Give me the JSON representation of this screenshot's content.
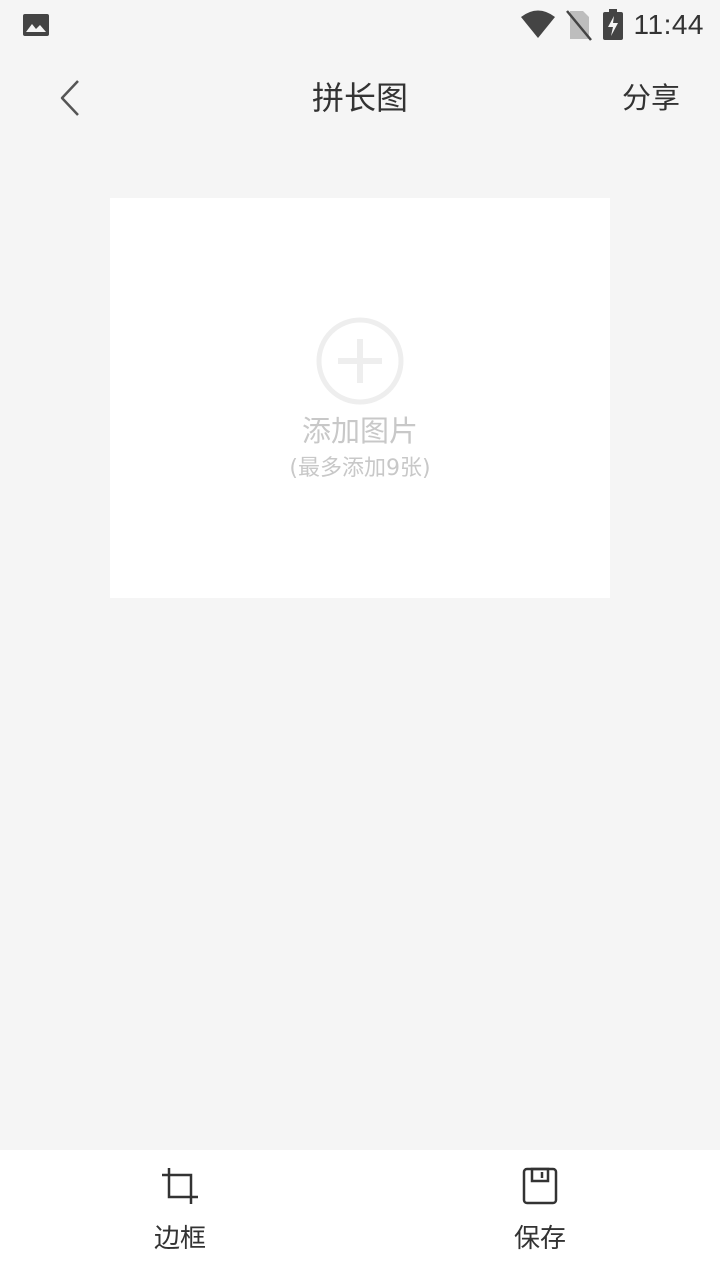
{
  "status_bar": {
    "left_icon": "image-icon",
    "icons": [
      "wifi-icon",
      "no-sim-icon",
      "battery-charging-icon"
    ],
    "time": "11:44"
  },
  "header": {
    "back_icon": "chevron-left-icon",
    "title": "拼长图",
    "share_label": "分享"
  },
  "canvas": {
    "add_icon": "plus-circle-icon",
    "add_title": "添加图片",
    "add_hint": "(最多添加9张)"
  },
  "bottom_toolbar": {
    "items": [
      {
        "icon": "crop-icon",
        "label": "边框"
      },
      {
        "icon": "save-icon",
        "label": "保存"
      }
    ]
  },
  "colors": {
    "background": "#f5f5f5",
    "surface": "#ffffff",
    "text": "#333333",
    "placeholder": "#c8c8c8"
  }
}
